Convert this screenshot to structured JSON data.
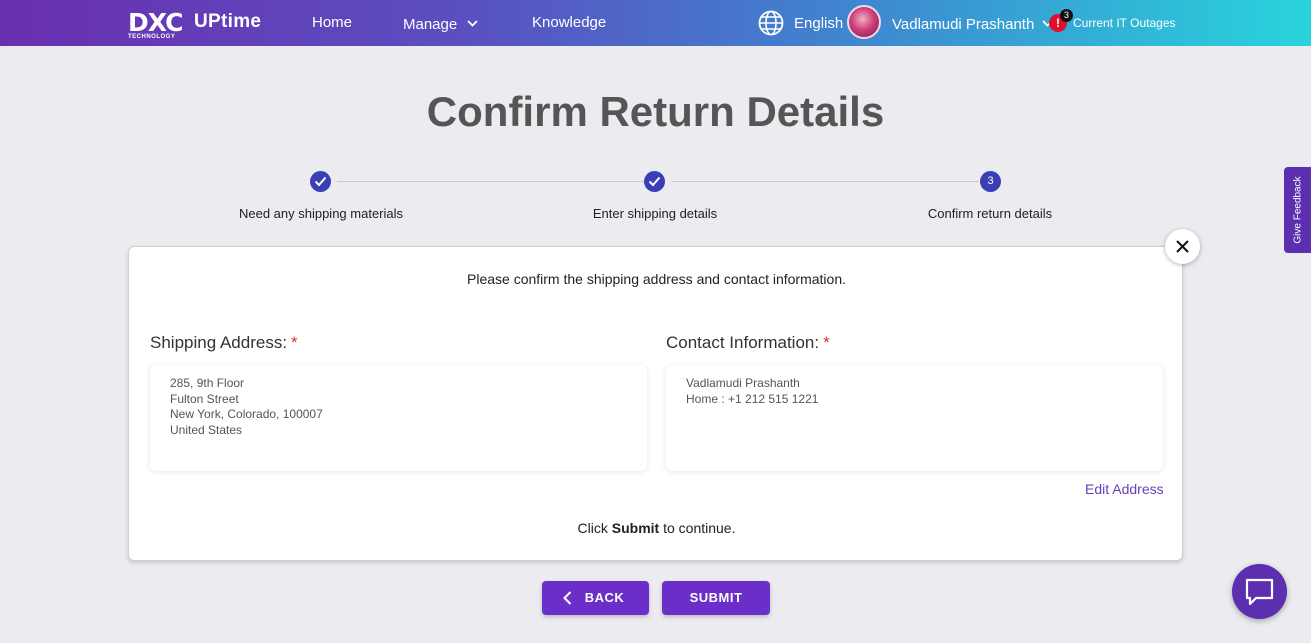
{
  "header": {
    "logo_text": "DXC",
    "logo_subtext": "TECHNOLOGY",
    "product_name": "UPtime",
    "nav": {
      "home": "Home",
      "manage": "Manage",
      "knowledge": "Knowledge"
    },
    "language": "English",
    "user_name": "Vadlamudi Prashanth",
    "alert_icon_text": "!",
    "alert_count": "3",
    "outages_label": "Current IT Outages"
  },
  "page": {
    "title": "Confirm Return Details"
  },
  "stepper": {
    "steps": [
      {
        "label": "Need any shipping materials",
        "state": "complete"
      },
      {
        "label": "Enter shipping details",
        "state": "complete"
      },
      {
        "label": "Confirm return details",
        "state": "current",
        "number": "3"
      }
    ]
  },
  "card": {
    "intro": "Please confirm the shipping address and contact information.",
    "shipping": {
      "label": "Shipping Address:",
      "required_mark": "*",
      "lines": [
        "285, 9th Floor",
        "Fulton Street",
        "New York, Colorado, 100007",
        "United States"
      ]
    },
    "contact": {
      "label": "Contact Information:",
      "required_mark": "*",
      "lines": [
        "Vadlamudi Prashanth",
        "Home : +1 212 515 1221"
      ]
    },
    "edit_link": "Edit Address",
    "continue_prefix": "Click ",
    "continue_bold": "Submit",
    "continue_suffix": " to continue."
  },
  "actions": {
    "back": "BACK",
    "submit": "SUBMIT"
  },
  "feedback_tab": "Give Feedback",
  "colors": {
    "accent_purple": "#6b2ec9",
    "step_blue": "#3b3fb6",
    "required_red": "#e03030",
    "link_purple": "#6b3db8"
  },
  "icons": {
    "globe": "globe-icon",
    "chevron": "chevron-down-icon",
    "check": "check-icon",
    "close": "close-icon",
    "back": "chevron-left-icon",
    "chat": "chat-icon"
  }
}
